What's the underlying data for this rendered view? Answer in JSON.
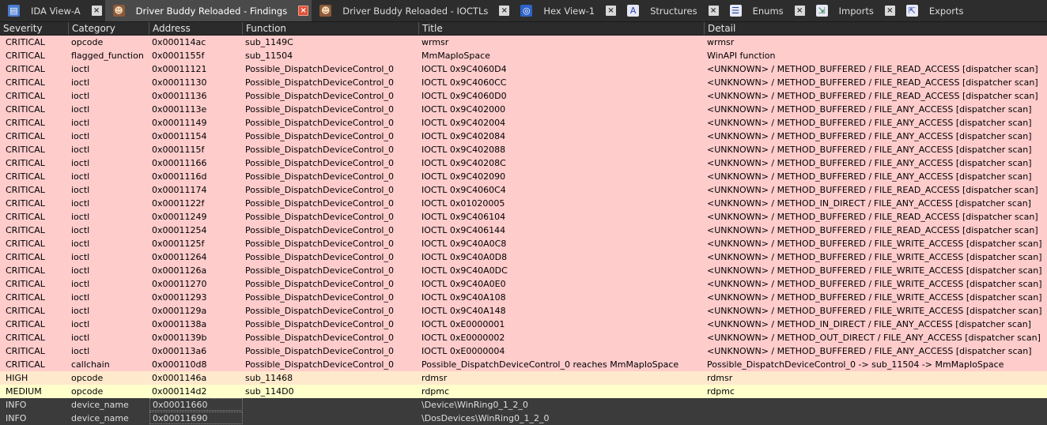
{
  "tabs": [
    {
      "label": "IDA View-A",
      "icon": "ida-view-icon",
      "active": false
    },
    {
      "label": "Driver Buddy Reloaded - Findings",
      "icon": "driver-buddy-avatar-icon",
      "active": true
    },
    {
      "label": "Driver Buddy Reloaded - IOCTLs",
      "icon": "driver-buddy-avatar-icon",
      "active": false
    },
    {
      "label": "Hex View-1",
      "icon": "hex-view-icon",
      "active": false
    },
    {
      "label": "Structures",
      "icon": "structures-icon",
      "active": false
    },
    {
      "label": "Enums",
      "icon": "enums-icon",
      "active": false
    },
    {
      "label": "Imports",
      "icon": "imports-icon",
      "active": false
    },
    {
      "label": "Exports",
      "icon": "exports-icon",
      "active": false
    }
  ],
  "close_glyph": "×",
  "columns": [
    "Severity",
    "Category",
    "Address",
    "Function",
    "Title",
    "Detail"
  ],
  "rows": [
    {
      "severity": "CRITICAL",
      "category": "opcode",
      "address": "0x000114ac",
      "function": "sub_1149C",
      "title": "wrmsr",
      "detail": "wrmsr"
    },
    {
      "severity": "CRITICAL",
      "category": "flagged_function",
      "address": "0x0001155f",
      "function": "sub_11504",
      "title": "MmMapIoSpace",
      "detail": "WinAPI function"
    },
    {
      "severity": "CRITICAL",
      "category": "ioctl",
      "address": "0x00011121",
      "function": "Possible_DispatchDeviceControl_0",
      "title": "IOCTL 0x9C4060D4",
      "detail": "<UNKNOWN> / METHOD_BUFFERED / FILE_READ_ACCESS [dispatcher scan]"
    },
    {
      "severity": "CRITICAL",
      "category": "ioctl",
      "address": "0x00011130",
      "function": "Possible_DispatchDeviceControl_0",
      "title": "IOCTL 0x9C4060CC",
      "detail": "<UNKNOWN> / METHOD_BUFFERED / FILE_READ_ACCESS [dispatcher scan]"
    },
    {
      "severity": "CRITICAL",
      "category": "ioctl",
      "address": "0x00011136",
      "function": "Possible_DispatchDeviceControl_0",
      "title": "IOCTL 0x9C4060D0",
      "detail": "<UNKNOWN> / METHOD_BUFFERED / FILE_READ_ACCESS [dispatcher scan]"
    },
    {
      "severity": "CRITICAL",
      "category": "ioctl",
      "address": "0x0001113e",
      "function": "Possible_DispatchDeviceControl_0",
      "title": "IOCTL 0x9C402000",
      "detail": "<UNKNOWN> / METHOD_BUFFERED / FILE_ANY_ACCESS [dispatcher scan]"
    },
    {
      "severity": "CRITICAL",
      "category": "ioctl",
      "address": "0x00011149",
      "function": "Possible_DispatchDeviceControl_0",
      "title": "IOCTL 0x9C402004",
      "detail": "<UNKNOWN> / METHOD_BUFFERED / FILE_ANY_ACCESS [dispatcher scan]"
    },
    {
      "severity": "CRITICAL",
      "category": "ioctl",
      "address": "0x00011154",
      "function": "Possible_DispatchDeviceControl_0",
      "title": "IOCTL 0x9C402084",
      "detail": "<UNKNOWN> / METHOD_BUFFERED / FILE_ANY_ACCESS [dispatcher scan]"
    },
    {
      "severity": "CRITICAL",
      "category": "ioctl",
      "address": "0x0001115f",
      "function": "Possible_DispatchDeviceControl_0",
      "title": "IOCTL 0x9C402088",
      "detail": "<UNKNOWN> / METHOD_BUFFERED / FILE_ANY_ACCESS [dispatcher scan]"
    },
    {
      "severity": "CRITICAL",
      "category": "ioctl",
      "address": "0x00011166",
      "function": "Possible_DispatchDeviceControl_0",
      "title": "IOCTL 0x9C40208C",
      "detail": "<UNKNOWN> / METHOD_BUFFERED / FILE_ANY_ACCESS [dispatcher scan]"
    },
    {
      "severity": "CRITICAL",
      "category": "ioctl",
      "address": "0x0001116d",
      "function": "Possible_DispatchDeviceControl_0",
      "title": "IOCTL 0x9C402090",
      "detail": "<UNKNOWN> / METHOD_BUFFERED / FILE_ANY_ACCESS [dispatcher scan]"
    },
    {
      "severity": "CRITICAL",
      "category": "ioctl",
      "address": "0x00011174",
      "function": "Possible_DispatchDeviceControl_0",
      "title": "IOCTL 0x9C4060C4",
      "detail": "<UNKNOWN> / METHOD_BUFFERED / FILE_READ_ACCESS [dispatcher scan]"
    },
    {
      "severity": "CRITICAL",
      "category": "ioctl",
      "address": "0x0001122f",
      "function": "Possible_DispatchDeviceControl_0",
      "title": "IOCTL 0x01020005",
      "detail": "<UNKNOWN> / METHOD_IN_DIRECT / FILE_ANY_ACCESS [dispatcher scan]"
    },
    {
      "severity": "CRITICAL",
      "category": "ioctl",
      "address": "0x00011249",
      "function": "Possible_DispatchDeviceControl_0",
      "title": "IOCTL 0x9C406104",
      "detail": "<UNKNOWN> / METHOD_BUFFERED / FILE_READ_ACCESS [dispatcher scan]"
    },
    {
      "severity": "CRITICAL",
      "category": "ioctl",
      "address": "0x00011254",
      "function": "Possible_DispatchDeviceControl_0",
      "title": "IOCTL 0x9C406144",
      "detail": "<UNKNOWN> / METHOD_BUFFERED / FILE_READ_ACCESS [dispatcher scan]"
    },
    {
      "severity": "CRITICAL",
      "category": "ioctl",
      "address": "0x0001125f",
      "function": "Possible_DispatchDeviceControl_0",
      "title": "IOCTL 0x9C40A0C8",
      "detail": "<UNKNOWN> / METHOD_BUFFERED / FILE_WRITE_ACCESS [dispatcher scan]"
    },
    {
      "severity": "CRITICAL",
      "category": "ioctl",
      "address": "0x00011264",
      "function": "Possible_DispatchDeviceControl_0",
      "title": "IOCTL 0x9C40A0D8",
      "detail": "<UNKNOWN> / METHOD_BUFFERED / FILE_WRITE_ACCESS [dispatcher scan]"
    },
    {
      "severity": "CRITICAL",
      "category": "ioctl",
      "address": "0x0001126a",
      "function": "Possible_DispatchDeviceControl_0",
      "title": "IOCTL 0x9C40A0DC",
      "detail": "<UNKNOWN> / METHOD_BUFFERED / FILE_WRITE_ACCESS [dispatcher scan]"
    },
    {
      "severity": "CRITICAL",
      "category": "ioctl",
      "address": "0x00011270",
      "function": "Possible_DispatchDeviceControl_0",
      "title": "IOCTL 0x9C40A0E0",
      "detail": "<UNKNOWN> / METHOD_BUFFERED / FILE_WRITE_ACCESS [dispatcher scan]"
    },
    {
      "severity": "CRITICAL",
      "category": "ioctl",
      "address": "0x00011293",
      "function": "Possible_DispatchDeviceControl_0",
      "title": "IOCTL 0x9C40A108",
      "detail": "<UNKNOWN> / METHOD_BUFFERED / FILE_WRITE_ACCESS [dispatcher scan]"
    },
    {
      "severity": "CRITICAL",
      "category": "ioctl",
      "address": "0x0001129a",
      "function": "Possible_DispatchDeviceControl_0",
      "title": "IOCTL 0x9C40A148",
      "detail": "<UNKNOWN> / METHOD_BUFFERED / FILE_WRITE_ACCESS [dispatcher scan]"
    },
    {
      "severity": "CRITICAL",
      "category": "ioctl",
      "address": "0x0001138a",
      "function": "Possible_DispatchDeviceControl_0",
      "title": "IOCTL 0xE0000001",
      "detail": "<UNKNOWN> / METHOD_IN_DIRECT / FILE_ANY_ACCESS [dispatcher scan]"
    },
    {
      "severity": "CRITICAL",
      "category": "ioctl",
      "address": "0x0001139b",
      "function": "Possible_DispatchDeviceControl_0",
      "title": "IOCTL 0xE0000002",
      "detail": "<UNKNOWN> / METHOD_OUT_DIRECT / FILE_ANY_ACCESS [dispatcher scan]"
    },
    {
      "severity": "CRITICAL",
      "category": "ioctl",
      "address": "0x000113a6",
      "function": "Possible_DispatchDeviceControl_0",
      "title": "IOCTL 0xE0000004",
      "detail": "<UNKNOWN> / METHOD_BUFFERED / FILE_ANY_ACCESS [dispatcher scan]"
    },
    {
      "severity": "CRITICAL",
      "category": "callchain",
      "address": "0x000110d8",
      "function": "Possible_DispatchDeviceControl_0",
      "title": "Possible_DispatchDeviceControl_0 reaches MmMapIoSpace",
      "detail": "Possible_DispatchDeviceControl_0 -> sub_11504 -> MmMapIoSpace"
    },
    {
      "severity": "HIGH",
      "category": "opcode",
      "address": "0x0001146a",
      "function": "sub_11468",
      "title": "rdmsr",
      "detail": "rdmsr"
    },
    {
      "severity": "MEDIUM",
      "category": "opcode",
      "address": "0x000114d2",
      "function": "sub_114D0",
      "title": "rdpmc",
      "detail": "rdpmc"
    },
    {
      "severity": "INFO",
      "category": "device_name",
      "address": "0x00011660",
      "function": "",
      "title": "\\Device\\WinRing0_1_2_0",
      "detail": ""
    },
    {
      "severity": "INFO",
      "category": "device_name",
      "address": "0x00011690",
      "function": "",
      "title": "\\DosDevices\\WinRing0_1_2_0",
      "detail": ""
    }
  ],
  "colors": {
    "critical_row": "#ffcccc",
    "high_row": "#ffe9cc",
    "medium_row": "#ffffcc",
    "info_row": "#3b3b3b",
    "active_tab_close": "#e0533a"
  }
}
